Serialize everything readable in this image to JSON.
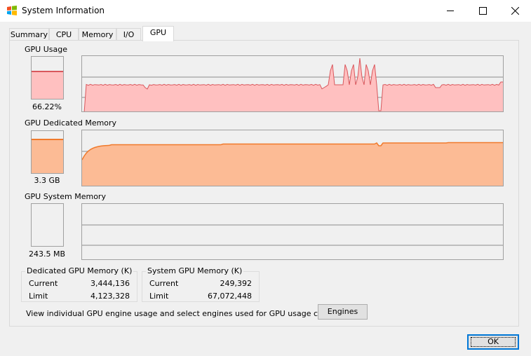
{
  "window": {
    "title": "System Information",
    "icon": "windows-flag-icon"
  },
  "tabs": [
    {
      "label": "Summary",
      "active": false
    },
    {
      "label": "CPU",
      "active": false
    },
    {
      "label": "Memory",
      "active": false
    },
    {
      "label": "I/O",
      "active": false
    },
    {
      "label": "GPU",
      "active": true
    }
  ],
  "gpu_usage": {
    "label": "GPU Usage",
    "value_text": "66.22%",
    "fill_fraction": 0.6622,
    "color_line": "#d9575c",
    "color_fill": "#ffc0c0"
  },
  "dedicated_memory": {
    "label": "GPU Dedicated Memory",
    "value_text": "3.3 GB",
    "fill_fraction": 0.82,
    "color_line": "#f07a2c",
    "color_fill": "#fcbb95"
  },
  "system_memory": {
    "label": "GPU System Memory",
    "value_text": "243.5 MB",
    "fill_fraction": 0.0
  },
  "dedicated_group": {
    "title": "Dedicated GPU Memory (K)",
    "rows": [
      {
        "key": "Current",
        "value": "3,444,136"
      },
      {
        "key": "Limit",
        "value": "4,123,328"
      }
    ]
  },
  "system_group": {
    "title": "System GPU Memory (K)",
    "rows": [
      {
        "key": "Current",
        "value": "249,392"
      },
      {
        "key": "Limit",
        "value": "67,072,448"
      }
    ]
  },
  "footer": {
    "info_text": "View individual GPU engine usage and select engines used for GPU usage calculations:",
    "engines_button": "Engines",
    "ok_button": "OK"
  }
}
